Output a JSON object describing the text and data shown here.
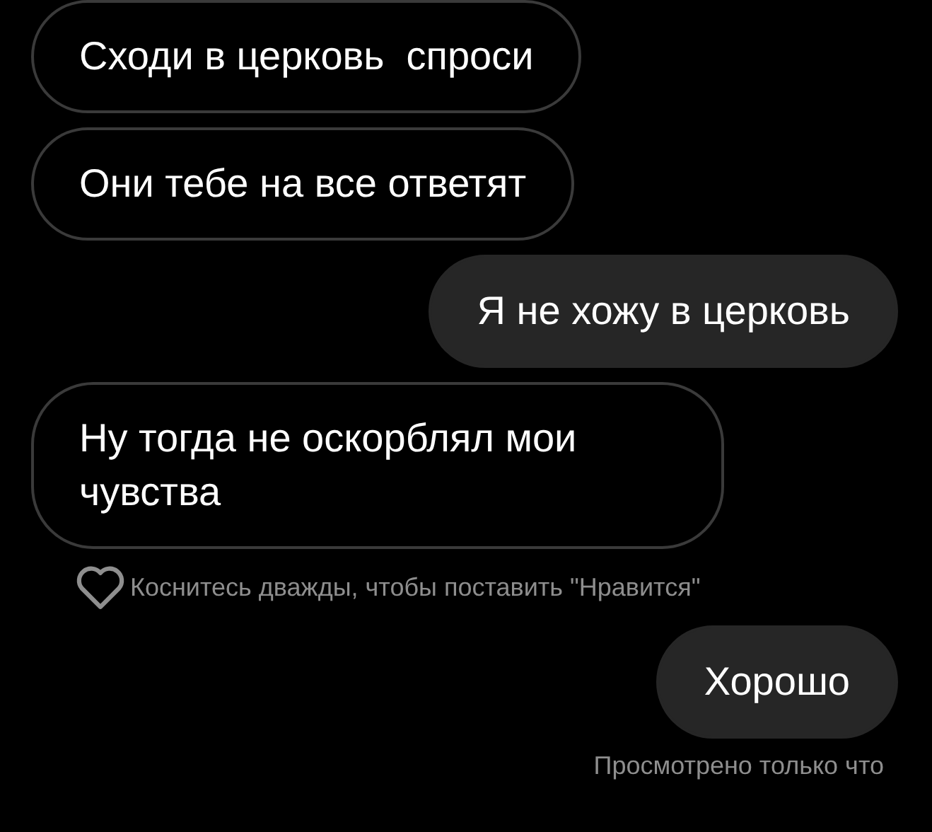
{
  "messages": [
    {
      "kind": "incoming",
      "text": "Сходи в церковь  спроси"
    },
    {
      "kind": "incoming",
      "text": "Они тебе на все ответят"
    },
    {
      "kind": "outgoing",
      "text": "Я не хожу в церковь"
    },
    {
      "kind": "incoming",
      "text": "Ну тогда не оскорблял мои чувства"
    }
  ],
  "like_hint": "Коснитесь дважды, чтобы поставить \"Нравится\"",
  "last_message": {
    "kind": "outgoing",
    "text": "Хорошо"
  },
  "seen_status": "Просмотрено только что"
}
